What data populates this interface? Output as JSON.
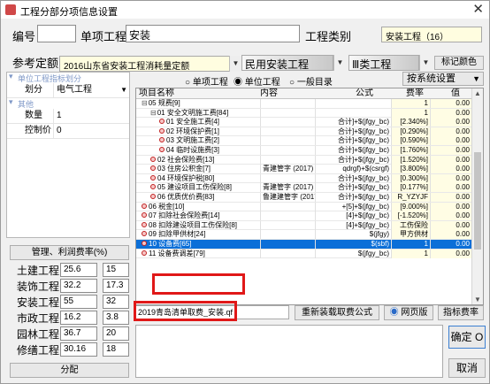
{
  "window": {
    "title": "工程分部分项信息设置",
    "close": "✕"
  },
  "header": {
    "code_label": "编号",
    "code_value": "",
    "item_label": "单项工程",
    "item_value": "安装",
    "category_label": "工程类别",
    "category_value": "安装工程（16）",
    "quota_label": "参考定额",
    "quota_value": "2016山东省安装工程消耗量定额",
    "type_value": "民用安装工程",
    "class_value": "Ⅲ类工程",
    "mark_color_label": "标记颜色"
  },
  "radio": {
    "options": [
      "单项工程",
      "单位工程",
      "一般目录"
    ],
    "selected_index": 1,
    "system_setting": "按系统设置"
  },
  "left_panel": {
    "section1": "单位工程指标划分",
    "row1_key": "划分",
    "row1_value": "电气工程",
    "section2": "其他",
    "row2_key": "数量",
    "row2_value": "1",
    "row3_key": "控制价",
    "row3_value": "0"
  },
  "rates": {
    "header": "管理、利润费率(%)",
    "items": [
      {
        "label": "土建工程",
        "a": "25.6",
        "b": "15"
      },
      {
        "label": "装饰工程",
        "a": "32.2",
        "b": "17.3"
      },
      {
        "label": "安装工程",
        "a": "55",
        "b": "32"
      },
      {
        "label": "市政工程",
        "a": "16.2",
        "b": "3.8"
      },
      {
        "label": "园林工程",
        "a": "36.7",
        "b": "20"
      },
      {
        "label": "修缮工程",
        "a": "30.16",
        "b": "18"
      }
    ],
    "assign_button": "分配"
  },
  "table": {
    "columns": [
      "项目名称",
      "内容",
      "公式",
      "费率",
      "值"
    ],
    "rows": [
      {
        "name": "05 规费[9]",
        "content": "",
        "formula": "",
        "rate": "1",
        "value": "0.00",
        "indent": 0,
        "node": "minus"
      },
      {
        "name": "01 安全文明施工费[84]",
        "content": "",
        "formula": "",
        "rate": "1",
        "value": "0.00",
        "indent": 1,
        "node": "minus"
      },
      {
        "name": "01 安全施工费[4]",
        "content": "",
        "formula": "合计]+$(jfgy_bc)",
        "rate": "[2.340%]",
        "value": "0.00",
        "indent": 2,
        "node": "dot"
      },
      {
        "name": "02 环境保护费[1]",
        "content": "",
        "formula": "合计]+$(jfgy_bc)",
        "rate": "[0.290%]",
        "value": "0.00",
        "indent": 2,
        "node": "dot"
      },
      {
        "name": "03 文明施工费[2]",
        "content": "",
        "formula": "合计]+$(jfgy_bc)",
        "rate": "[0.590%]",
        "value": "0.00",
        "indent": 2,
        "node": "dot"
      },
      {
        "name": "04 临时设施费[3]",
        "content": "",
        "formula": "合计]+$(jfgy_bc)",
        "rate": "[1.760%]",
        "value": "0.00",
        "indent": 2,
        "node": "dot"
      },
      {
        "name": "02 社会保险费[13]",
        "content": "",
        "formula": "合计]+$(jfgy_bc)",
        "rate": "[1.520%]",
        "value": "0.00",
        "indent": 1,
        "node": "dot"
      },
      {
        "name": "03 住房公积金[7]",
        "content": "青建管字 (2017)",
        "formula": "qdrgf)+$(csrgf)",
        "rate": "[3.800%]",
        "value": "0.00",
        "indent": 1,
        "node": "dot"
      },
      {
        "name": "04 环境保护税[80]",
        "content": "",
        "formula": "合计]+$(jfgy_bc)",
        "rate": "[0.300%]",
        "value": "0.00",
        "indent": 1,
        "node": "dot"
      },
      {
        "name": "05 建设项目工伤保险[8]",
        "content": "青建管字 (2017)",
        "formula": "合计]+$(jfgy_bc)",
        "rate": "[0.177%]",
        "value": "0.00",
        "indent": 1,
        "node": "dot"
      },
      {
        "name": "06 优质优价费[83]",
        "content": "鲁建建管字 (2017)",
        "formula": "合计]+$(jfgy_bc)",
        "rate": "R_YZYJF",
        "value": "0.00",
        "indent": 1,
        "node": "dot"
      },
      {
        "name": "06 税金[10]",
        "content": "",
        "formula": "+[5]+$(jfgy_bc)",
        "rate": "[9.000%]",
        "value": "0.00",
        "indent": 0,
        "node": "dot"
      },
      {
        "name": "07 扣除社会保险费[14]",
        "content": "",
        "formula": "[4]+$(jfgy_bc)",
        "rate": "[-1.520%]",
        "value": "0.00",
        "indent": 0,
        "node": "dot"
      },
      {
        "name": "08 扣除建设项目工伤保险[8]",
        "content": "",
        "formula": "[4]+$(jfgy_bc)",
        "rate": "工伤保险",
        "value": "0.00",
        "indent": 0,
        "node": "dot"
      },
      {
        "name": "09 扣除甲供材[24]",
        "content": "",
        "formula": "$(jfgy)",
        "rate": "甲方供材",
        "value": "0.00",
        "indent": 0,
        "node": "dot"
      },
      {
        "name": "10 设备费[65]",
        "content": "",
        "formula": "$(sbf)",
        "rate": "1",
        "value": "0.00",
        "indent": 0,
        "node": "dot",
        "selected": true
      },
      {
        "name": "11 设备费调差[79]",
        "content": "",
        "formula": "$(jfgy_bc)",
        "rate": "1",
        "value": "0.00",
        "indent": 0,
        "node": "dot"
      }
    ]
  },
  "bottom": {
    "fee_file": "2019青岛清单取费_安装.qf",
    "reload_button": "重新装载取费公式",
    "web_button": "网页版",
    "rate_button": "指标费率",
    "ok_button": "确定 O",
    "cancel_button": "取消"
  }
}
